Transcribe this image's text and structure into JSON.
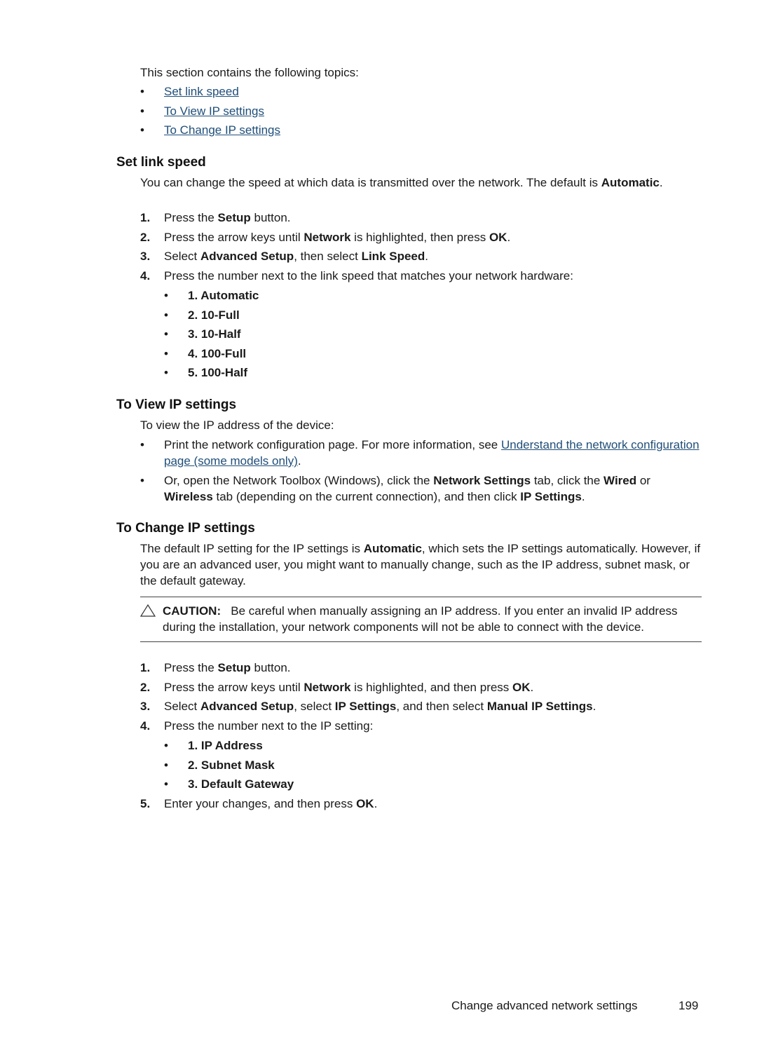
{
  "intro": "This section contains the following topics:",
  "toc": [
    {
      "label": "Set link speed"
    },
    {
      "label": "To View IP settings"
    },
    {
      "label": "To Change IP settings"
    }
  ],
  "bullet_char": "•",
  "link_speed": {
    "heading": "Set link speed",
    "para_text": "You can change the speed at which data is transmitted over the network. The default is ",
    "para_bold": "Automatic",
    "para_end": ".",
    "steps": [
      {
        "num": "1.",
        "parts": [
          [
            "Press the ",
            false
          ],
          [
            "Setup",
            true
          ],
          [
            " button.",
            false
          ]
        ]
      },
      {
        "num": "2.",
        "parts": [
          [
            "Press the arrow keys until ",
            false
          ],
          [
            "Network",
            true
          ],
          [
            " is highlighted, then press ",
            false
          ],
          [
            "OK",
            true
          ],
          [
            ".",
            false
          ]
        ]
      },
      {
        "num": "3.",
        "parts": [
          [
            "Select ",
            false
          ],
          [
            "Advanced Setup",
            true
          ],
          [
            ", then select ",
            false
          ],
          [
            "Link Speed",
            true
          ],
          [
            ".",
            false
          ]
        ]
      },
      {
        "num": "4.",
        "parts": [
          [
            "Press the number next to the link speed that matches your network hardware:",
            false
          ]
        ]
      }
    ],
    "options": [
      "1. Automatic",
      "2. 10-Full",
      "3. 10-Half",
      "4. 100-Full",
      "5. 100-Half"
    ]
  },
  "view_ip": {
    "heading": "To View IP settings",
    "intro": "To view the IP address of the device:",
    "bullet1_text": "Print the network configuration page. For more information, see ",
    "bullet1_link": "Understand the network configuration page (some models only)",
    "bullet1_end": ".",
    "bullet2_parts": [
      [
        "Or, open the Network Toolbox (Windows), click the ",
        false
      ],
      [
        "Network Settings",
        true
      ],
      [
        " tab, click the ",
        false
      ],
      [
        "Wired",
        true
      ],
      [
        " or ",
        false
      ],
      [
        "Wireless",
        true
      ],
      [
        " tab (depending on the current connection), and then click ",
        false
      ],
      [
        "IP Settings",
        true
      ],
      [
        ".",
        false
      ]
    ]
  },
  "change_ip": {
    "heading": "To Change IP settings",
    "para_parts": [
      [
        "The default IP setting for the IP settings is ",
        false
      ],
      [
        "Automatic",
        true
      ],
      [
        ", which sets the IP settings automatically. However, if you are an advanced user, you might want to manually change, such as the IP address, subnet mask, or the default gateway.",
        false
      ]
    ],
    "caution_label": "CAUTION:",
    "caution_text": "Be careful when manually assigning an IP address. If you enter an invalid IP address during the installation, your network components will not be able to connect with the device.",
    "caution_icon": "△",
    "steps": [
      {
        "num": "1.",
        "parts": [
          [
            "Press the ",
            false
          ],
          [
            "Setup",
            true
          ],
          [
            " button.",
            false
          ]
        ]
      },
      {
        "num": "2.",
        "parts": [
          [
            "Press the arrow keys until ",
            false
          ],
          [
            "Network",
            true
          ],
          [
            " is highlighted, and then press ",
            false
          ],
          [
            "OK",
            true
          ],
          [
            ".",
            false
          ]
        ]
      },
      {
        "num": "3.",
        "parts": [
          [
            "Select ",
            false
          ],
          [
            "Advanced Setup",
            true
          ],
          [
            ", select ",
            false
          ],
          [
            "IP Settings",
            true
          ],
          [
            ", and then select ",
            false
          ],
          [
            "Manual IP Settings",
            true
          ],
          [
            ".",
            false
          ]
        ]
      },
      {
        "num": "4.",
        "parts": [
          [
            "Press the number next to the IP setting:",
            false
          ]
        ]
      }
    ],
    "options": [
      "1. IP Address",
      "2. Subnet Mask",
      "3. Default Gateway"
    ],
    "step5": {
      "num": "5.",
      "parts": [
        [
          "Enter your changes, and then press ",
          false
        ],
        [
          "OK",
          true
        ],
        [
          ".",
          false
        ]
      ]
    }
  },
  "footer": {
    "section": "Change advanced network settings",
    "page_number": "199"
  },
  "colors": {
    "link": "#1f4e79",
    "text": "#1a1a1a"
  }
}
